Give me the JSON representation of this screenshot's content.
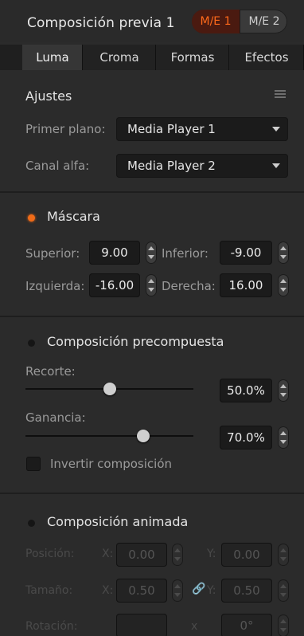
{
  "header": {
    "title": "Composición previa 1",
    "me1": "M/E 1",
    "me2": "M/E 2",
    "accent": "#f06b18"
  },
  "tabs": [
    "Luma",
    "Croma",
    "Formas",
    "Efectos"
  ],
  "ajustes": {
    "title": "Ajustes",
    "menu_icon": "hamburger-menu-icon",
    "primer_plano_label": "Primer plano:",
    "primer_plano_value": "Media Player 1",
    "canal_alfa_label": "Canal alfa:",
    "canal_alfa_value": "Media Player 2"
  },
  "mascara": {
    "title": "Máscara",
    "enabled": true,
    "superior_label": "Superior:",
    "superior_value": "9.00",
    "inferior_label": "Inferior:",
    "inferior_value": "-9.00",
    "izquierda_label": "Izquierda:",
    "izquierda_value": "-16.00",
    "derecha_label": "Derecha:",
    "derecha_value": "16.00"
  },
  "precompuesta": {
    "title": "Composición precompuesta",
    "enabled": false,
    "recorte_label": "Recorte:",
    "recorte_value": "50.0%",
    "recorte_level": 0.5,
    "ganancia_label": "Ganancia:",
    "ganancia_value": "70.0%",
    "ganancia_level": 0.7,
    "invertir_label": "Invertir composición"
  },
  "animada": {
    "title": "Composición animada",
    "enabled": false,
    "posicion_label": "Posición:",
    "x_label": "X:",
    "y_label": "Y:",
    "pos_x": "0.00",
    "pos_y": "0.00",
    "tamano_label": "Tamaño:",
    "size_x": "0.50",
    "size_y": "0.50",
    "link_icon": "chain-link-icon",
    "rotacion_label": "Rotación:",
    "rot_x_label": "x",
    "rot_value": "0°"
  }
}
